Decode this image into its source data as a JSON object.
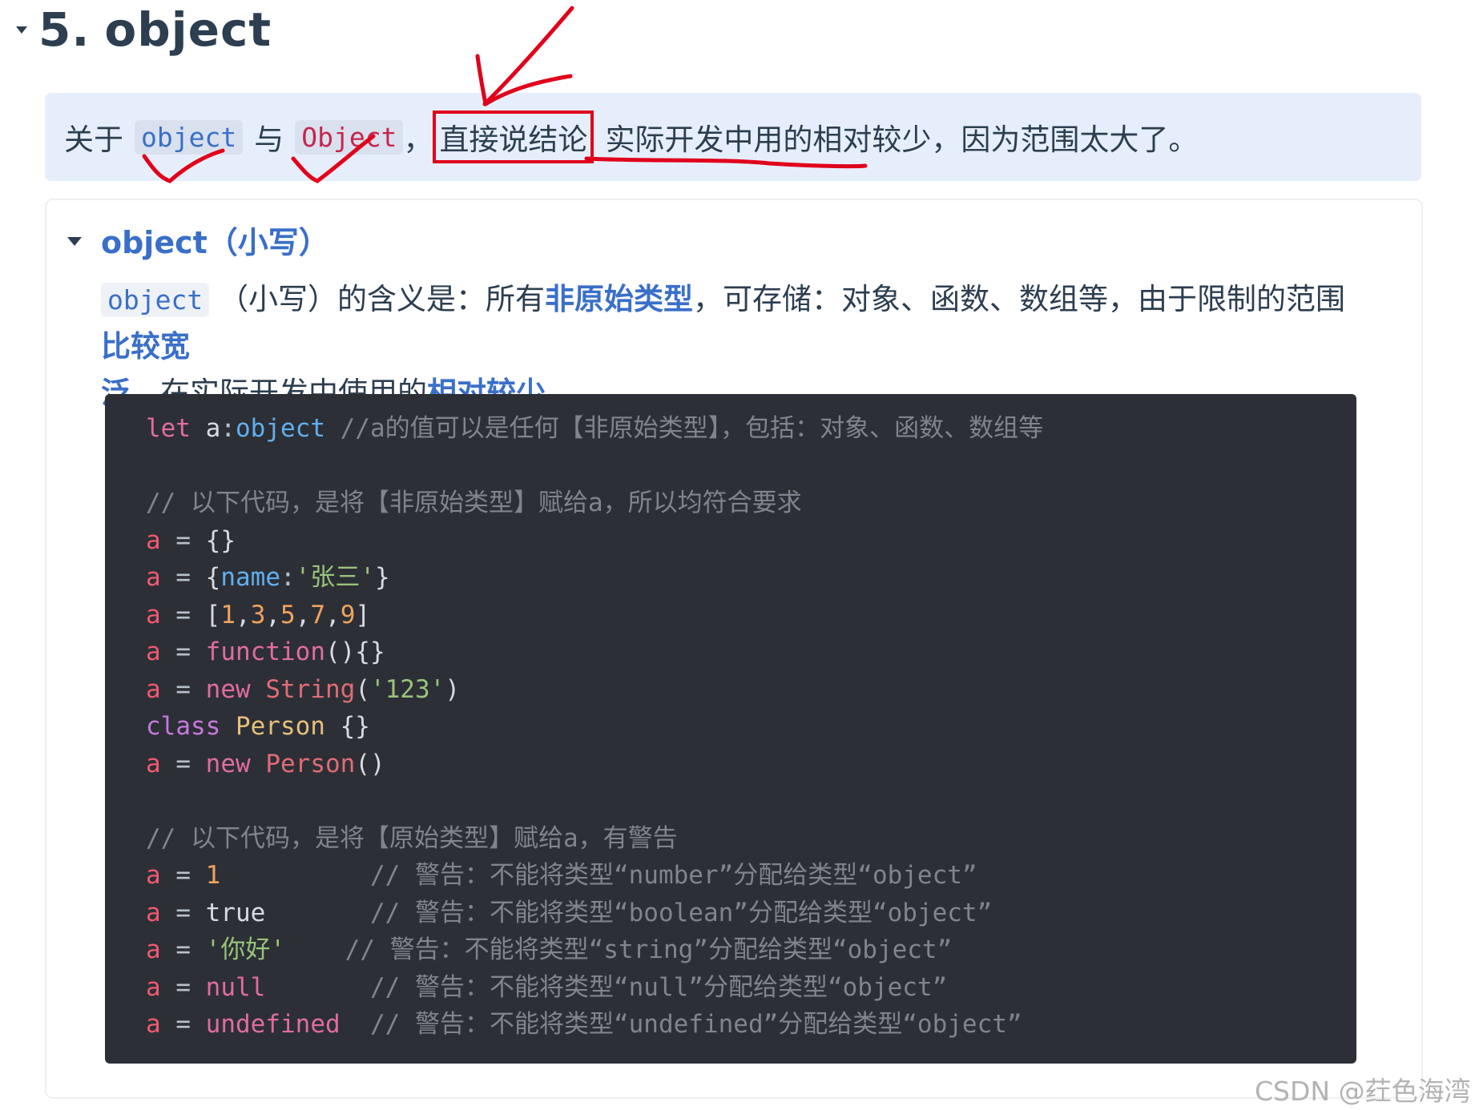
{
  "section": {
    "number": "5.",
    "title": "object"
  },
  "tip": {
    "prefix": "关于",
    "chip1": "object",
    "conj": "与",
    "chip2": "Object",
    "comma": "，",
    "boxed": "直接说结论",
    "conclusion": "实际开发中用的相对较少，因为范围太大了。"
  },
  "details": {
    "summary": "object（小写）",
    "para_chip": "object",
    "para_1": "（小写）的含义是：所有",
    "para_hl1": "非原始类型",
    "para_2": "，可存储：对象、函数、数组等，由于限制的范围",
    "para_hl2a": "比较宽",
    "para_hl2b": "泛",
    "para_3": "，在实际开发中使用的",
    "para_hl3": "相对较少",
    "para_4": "。"
  },
  "code": {
    "l1_let": "let ",
    "l1_var": "a",
    "l1_colon": ":",
    "l1_type": "object",
    "l1_comment": " //a的值可以是任何【非原始类型】，包括：对象、函数、数组等",
    "l3_comment": "// 以下代码，是将【非原始类型】赋给a，所以均符合要求",
    "a": "a",
    "eq": " = ",
    "l4_val": "{}",
    "l5_open": "{",
    "l5_prop": "name",
    "l5_colon": ":",
    "l5_str": "'张三'",
    "l5_close": "}",
    "l6_open": "[",
    "l6_n1": "1",
    "l6_n2": "3",
    "l6_n3": "5",
    "l6_n4": "7",
    "l6_n5": "9",
    "l6_comma": ",",
    "l6_close": "]",
    "l7_kw": "function",
    "l7_rest": "(){}",
    "l8_new": "new ",
    "l8_fn": "String",
    "l8_open": "(",
    "l8_str": "'123'",
    "l8_close": ")",
    "l9_class": "class ",
    "l9_name": "Person",
    "l9_rest": " {}",
    "l10_new": "new ",
    "l10_fn": "Person",
    "l10_rest": "()",
    "l12_comment": "// 以下代码，是将【原始类型】赋给a，有警告",
    "l13_val": "1",
    "l13_pad": "          ",
    "l13_comment": "// 警告：不能将类型“number”分配给类型“object”",
    "l14_val": "true",
    "l14_pad": "       ",
    "l14_comment": "// 警告：不能将类型“boolean”分配给类型“object”",
    "l15_val": "'你好'",
    "l15_pad": "    ",
    "l15_comment": "// 警告：不能将类型“string”分配给类型“object”",
    "l16_val": "null",
    "l16_pad": "       ",
    "l16_comment": "// 警告：不能将类型“null”分配给类型“object”",
    "l17_val": "undefined",
    "l17_pad": "  ",
    "l17_comment": "// 警告：不能将类型“undefined”分配给类型“object”"
  },
  "watermark": "CSDN @荭色海湾",
  "colors": {
    "accent": "#3a6fc9",
    "annotation_red": "#e0001b",
    "tip_bg": "#e6eefb",
    "code_bg": "#2c2f36"
  }
}
